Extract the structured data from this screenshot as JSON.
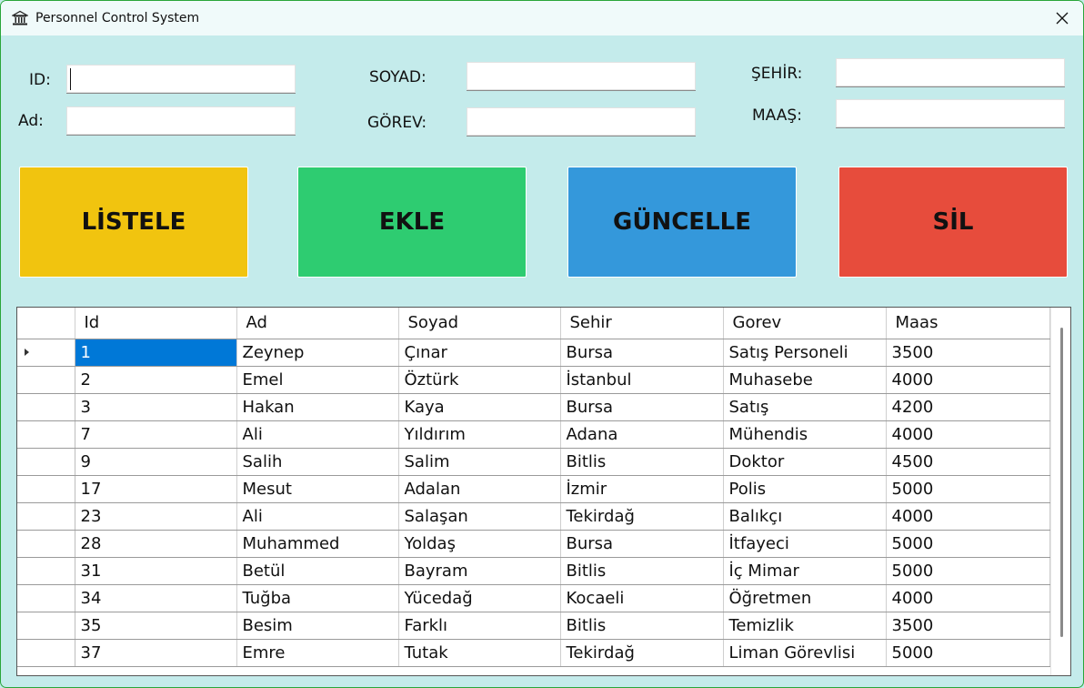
{
  "window": {
    "title": "Personnel Control System"
  },
  "form": {
    "id_label": "ID:",
    "ad_label": "Ad:",
    "soyad_label": "SOYAD:",
    "gorev_label": "GÖREV:",
    "sehir_label": "ŞEHİR:",
    "maas_label": "MAAŞ:",
    "id_value": "",
    "ad_value": "",
    "soyad_value": "",
    "gorev_value": "",
    "sehir_value": "",
    "maas_value": ""
  },
  "buttons": {
    "listele": {
      "label": "LİSTELE",
      "color": "#f1c40f"
    },
    "ekle": {
      "label": "EKLE",
      "color": "#2ecc71"
    },
    "guncelle": {
      "label": "GÜNCELLE",
      "color": "#3498db"
    },
    "sil": {
      "label": "SİL",
      "color": "#e74c3c"
    }
  },
  "grid": {
    "columns": [
      "Id",
      "Ad",
      "Soyad",
      "Sehir",
      "Gorev",
      "Maas"
    ],
    "rows": [
      [
        "1",
        "Zeynep",
        "Çınar",
        "Bursa",
        "Satış Personeli",
        "3500"
      ],
      [
        "2",
        "Emel",
        "Öztürk",
        "İstanbul",
        "Muhasebe",
        "4000"
      ],
      [
        "3",
        "Hakan",
        "Kaya",
        "Bursa",
        "Satış",
        "4200"
      ],
      [
        "7",
        "Ali",
        "Yıldırım",
        "Adana",
        "Mühendis",
        "4000"
      ],
      [
        "9",
        "Salih",
        "Salim",
        "Bitlis",
        "Doktor",
        "4500"
      ],
      [
        "17",
        "Mesut",
        "Adalan",
        "İzmir",
        "Polis",
        "5000"
      ],
      [
        "23",
        "Ali",
        "Salaşan",
        "Tekirdağ",
        "Balıkçı",
        "4000"
      ],
      [
        "28",
        "Muhammed",
        "Yoldaş",
        "Bursa",
        "İtfayeci",
        "5000"
      ],
      [
        "31",
        "Betül",
        "Bayram",
        "Bitlis",
        "İç Mimar",
        "5000"
      ],
      [
        "34",
        "Tuğba",
        "Yücedağ",
        "Kocaeli",
        "Öğretmen",
        "4000"
      ],
      [
        "35",
        "Besim",
        "Farklı",
        "Bitlis",
        "Temizlik",
        "3500"
      ],
      [
        "37",
        "Emre",
        "Tutak",
        "Tekirdağ",
        "Liman Görevlisi",
        "5000"
      ]
    ],
    "selected_row": 0
  }
}
